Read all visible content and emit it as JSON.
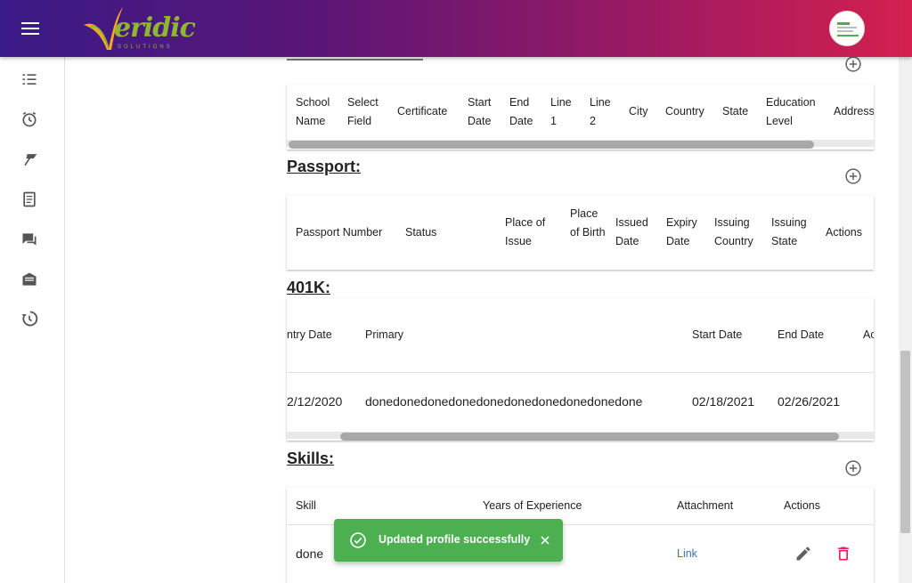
{
  "brand": {
    "logo_text": "eridic",
    "logo_sub": "SOLUTIONS"
  },
  "sidebar": {
    "items": [
      {
        "name": "tasks"
      },
      {
        "name": "alarm"
      },
      {
        "name": "goals"
      },
      {
        "name": "document"
      },
      {
        "name": "chat"
      },
      {
        "name": "mail"
      },
      {
        "name": "history"
      }
    ]
  },
  "education": {
    "columns": [
      "School Name",
      "Select Field",
      "Certificate",
      "Start Date",
      "End Date",
      "Line 1",
      "Line 2",
      "City",
      "Country",
      "State",
      "Education Level",
      "Address"
    ]
  },
  "passport": {
    "title": "Passport:",
    "columns": [
      "Passport Number",
      "Status",
      "Place of Issue",
      "Place of Birth",
      "Issued Date",
      "Expiry Date",
      "Issuing Country",
      "Issuing State",
      "Actions"
    ]
  },
  "k401": {
    "title": "401K:",
    "columns": [
      "ntry Date",
      "Primary",
      "Start Date",
      "End Date",
      "Ac"
    ],
    "row": {
      "entry_date": "2/12/2020",
      "primary": "donedonedonedonedonedonedonedonedonedone",
      "start_date": "02/18/2021",
      "end_date": "02/26/2021"
    }
  },
  "skills": {
    "title": "Skills:",
    "columns": [
      "Skill",
      "Years of Experience",
      "Attachment",
      "Actions"
    ],
    "row": {
      "skill": "done",
      "attachment": "Link"
    }
  },
  "snackbar": {
    "message": "Updated profile successfully"
  },
  "colors": {
    "success": "#4caf50",
    "delete": "#e91e63",
    "link": "#3f6fb5"
  }
}
